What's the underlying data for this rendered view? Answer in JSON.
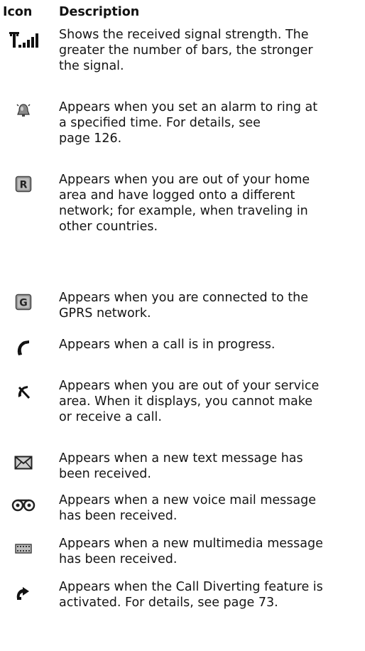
{
  "header": {
    "icon_col": "Icon",
    "desc_col": "Description"
  },
  "rows": [
    {
      "icon": "signal-strength-icon",
      "lines": [
        "Shows the received signal strength. The",
        "greater the number of bars, the stronger",
        "the signal."
      ]
    },
    {
      "icon": "alarm-bell-icon",
      "lines": [
        "Appears when you set an alarm to ring at",
        "a specified time. For details, see",
        "page 126."
      ]
    },
    {
      "icon": "roaming-r-icon",
      "lines": [
        "Appears when you are out of your home",
        "area and have logged onto a different",
        "network; for example, when traveling in",
        "other countries."
      ]
    },
    {
      "icon": "gprs-g-icon",
      "lines": [
        "Appears when you are connected to the",
        "GPRS network."
      ]
    },
    {
      "icon": "call-in-progress-icon",
      "lines": [
        "Appears when a call is in progress."
      ]
    },
    {
      "icon": "no-service-icon",
      "lines": [
        "Appears when you are out of your service",
        "area. When it displays, you cannot make",
        "or receive a call."
      ]
    },
    {
      "icon": "envelope-icon",
      "lines": [
        "Appears when a new text message has",
        "been received."
      ]
    },
    {
      "icon": "voicemail-icon",
      "lines": [
        "Appears when a new voice mail message",
        "has been received."
      ]
    },
    {
      "icon": "multimedia-message-icon",
      "lines": [
        "Appears when a new multimedia message",
        "has been received."
      ]
    },
    {
      "icon": "call-divert-icon",
      "lines": [
        "Appears when the Call Diverting feature is",
        "activated. For details, see page 73."
      ]
    }
  ]
}
